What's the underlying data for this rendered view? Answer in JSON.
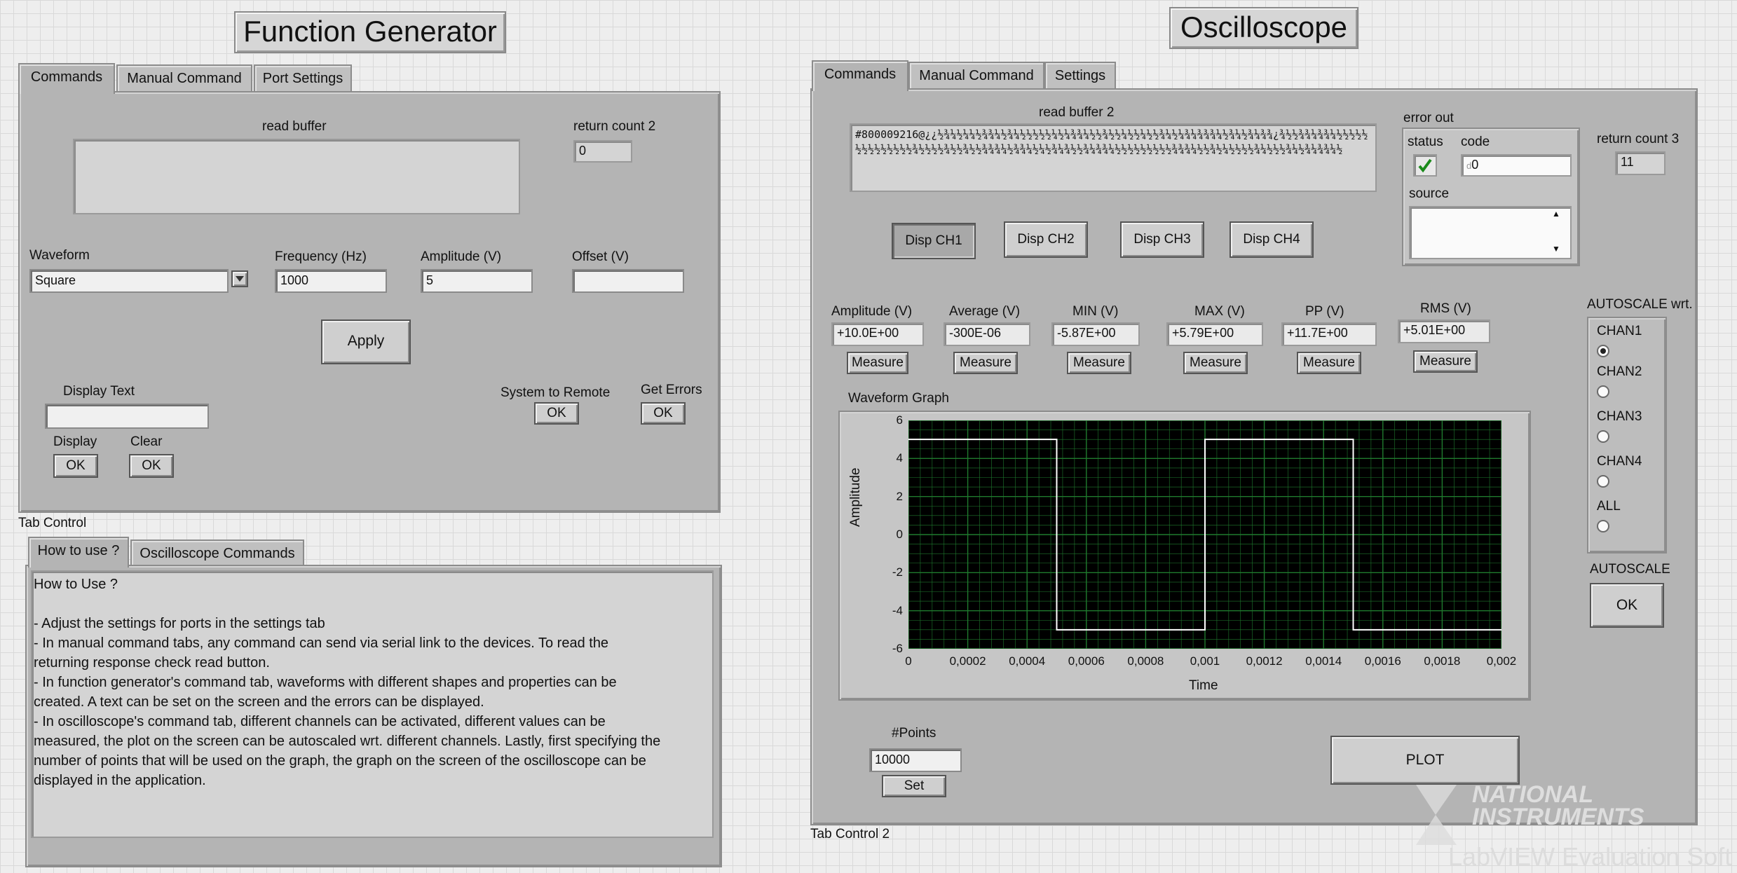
{
  "fg": {
    "title": "Function Generator",
    "tabs": [
      "Commands",
      "Manual Command",
      "Port Settings"
    ],
    "read_buffer_label": "read buffer",
    "read_buffer_value": "",
    "return_count_label": "return count 2",
    "return_count_value": "0",
    "waveform_label": "Waveform",
    "waveform_value": "Square",
    "frequency_label": "Frequency (Hz)",
    "frequency_value": "1000",
    "amplitude_label": "Amplitude (V)",
    "amplitude_value": "5",
    "offset_label": "Offset (V)",
    "offset_value": "",
    "apply_label": "Apply",
    "display_text_label": "Display Text",
    "display_text_value": "",
    "display_label": "Display",
    "clear_label": "Clear",
    "system_remote_label": "System to Remote",
    "get_errors_label": "Get Errors",
    "ok_label": "OK"
  },
  "tab_control_label": "Tab Control",
  "help": {
    "tabs": [
      "How to use ?",
      "Oscilloscope Commands"
    ],
    "text": "How to Use ?\n\n-  Adjust the settings for ports in the settings tab\n- In manual command tabs, any command can send via serial link to the devices. To read the\nreturning response check read button.\n- In function generator's command tab, waveforms with different shapes and properties can be\ncreated. A text can be set on the screen and the errors can be displayed.\n- In oscilloscope's command tab, different channels can be activated, different values can be\nmeasured, the plot on the screen can be autoscaled wrt. different channels. Lastly, first specifying the\nnumber of points that will be used on the graph, the graph on the screen of the oscilloscope can be\ndisplayed in the application."
  },
  "osc": {
    "title": "Oscilloscope",
    "tabs": [
      "Commands",
      "Manual Command",
      "Settings"
    ],
    "read_buffer_label": "read buffer 2",
    "read_buffer_value": "#800009216@¿¿½¾¼½¼¼½¾¾¼½¾¼½½½½½¼½¼¾¾¼½½¾½½¼½½¼½½¾¼½¼¾¼¾¾¾¼½¾¼½¾¼¾¾¿¾½½¾¾¼¾¾¼½½½½½½½½½½½½½½¾½½½½¾½½¾½½¾¾¾¼½¾¾¼½¼½¾¼¾½½¾¼¾¾¼½½½½½½½½½¾¾¾¼½½¾½¼½½½½¾¼½½½¾¼½¾¼¾¾¼½",
    "error_out_label": "error out",
    "status_label": "status",
    "code_label": "code",
    "code_value": "0",
    "source_label": "source",
    "source_value": "",
    "return_count_label": "return count 3",
    "return_count_value": "11",
    "disp_buttons": [
      "Disp CH1",
      "Disp CH2",
      "Disp CH3",
      "Disp CH4"
    ],
    "measurements": [
      {
        "label": "Amplitude (V)",
        "value": "+10.0E+00"
      },
      {
        "label": "Average (V)",
        "value": "-300E-06"
      },
      {
        "label": "MIN (V)",
        "value": "-5.87E+00"
      },
      {
        "label": "MAX (V)",
        "value": "+5.79E+00"
      },
      {
        "label": "PP (V)",
        "value": "+11.7E+00"
      },
      {
        "label": "RMS (V)",
        "value": "+5.01E+00"
      }
    ],
    "measure_label": "Measure",
    "autoscale_wrt_label": "AUTOSCALE wrt.",
    "channels": [
      "CHAN1",
      "CHAN2",
      "CHAN3",
      "CHAN4",
      "ALL"
    ],
    "selected_channel": "CHAN1",
    "autoscale_label": "AUTOSCALE",
    "ok_label": "OK",
    "graph_label": "Waveform Graph",
    "points_label": "#Points",
    "points_value": "10000",
    "set_label": "Set",
    "plot_label": "PLOT",
    "tab_control_label": "Tab Control 2"
  },
  "watermark": {
    "brand": "NATIONAL INSTRUMENTS",
    "product": "LabVIEW Evaluation Soft"
  },
  "chart_data": {
    "type": "line",
    "title": "",
    "xlabel": "Time",
    "ylabel": "Amplitude",
    "xlim": [
      0,
      0.002
    ],
    "ylim": [
      -6,
      6
    ],
    "x_ticks": [
      "0",
      "0,0002",
      "0,0004",
      "0,0006",
      "0,0008",
      "0,001",
      "0,0012",
      "0,0014",
      "0,0016",
      "0,0018",
      "0,002"
    ],
    "y_ticks": [
      "6",
      "4",
      "2",
      "0",
      "-2",
      "-4",
      "-6"
    ],
    "grid": true,
    "series": [
      {
        "x": [
          0,
          0.0005,
          0.0005,
          0.001,
          0.001,
          0.0015,
          0.0015,
          0.002
        ],
        "y": [
          5.0,
          5.0,
          -5.0,
          -5.0,
          5.0,
          5.0,
          -5.0,
          -5.0
        ],
        "color": "#ffffff"
      }
    ],
    "plot_background": "#000000",
    "grid_color": "#1f7a2e"
  }
}
